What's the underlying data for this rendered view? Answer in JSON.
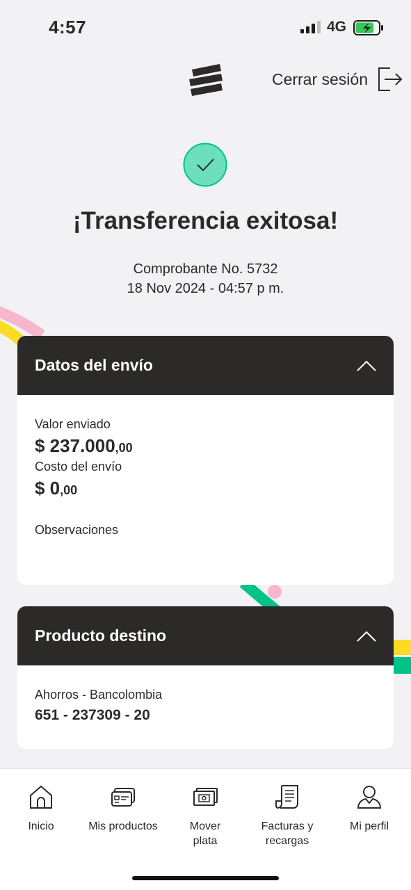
{
  "status_bar": {
    "time": "4:57",
    "network": "4G",
    "battery_level": 0.8,
    "battery_charging": true,
    "battery_color": "#34c759"
  },
  "header": {
    "logo_icon": "bancolombia-logo-icon",
    "logout_label": "Cerrar sesión",
    "logout_icon": "logout-icon"
  },
  "colors": {
    "dark": "#2c2a29",
    "success_green": "#6ce0bd",
    "accent_yellow": "#fdda24",
    "accent_pink": "#f7b6cc",
    "accent_green": "#00c389"
  },
  "result": {
    "icon": "check-circle-icon",
    "title": "¡Transferencia exitosa!",
    "voucher": "Comprobante No. 5732",
    "datetime": "18 Nov 2024 - 04:57 p m."
  },
  "shipment": {
    "title": "Datos del envío",
    "toggle_icon": "chevron-up-icon",
    "sent_label": "Valor enviado",
    "sent_amount": "$ 237.000",
    "sent_cents": ",00",
    "cost_label": "Costo del envío",
    "cost_amount": "$ 0",
    "cost_cents": ",00",
    "notes_label": "Observaciones"
  },
  "destination": {
    "title": "Producto destino",
    "toggle_icon": "chevron-up-icon",
    "account_type": "Ahorros - Bancolombia",
    "account_number": "651 - 237309 - 20"
  },
  "bottom_nav": {
    "items": [
      {
        "label": "Inicio",
        "icon": "home-icon"
      },
      {
        "label": "Mis productos",
        "icon": "cards-icon"
      },
      {
        "label": "Mover\nplata",
        "icon": "money-icon"
      },
      {
        "label": "Facturas y\nrecargas",
        "icon": "receipt-icon"
      },
      {
        "label": "Mi perfil",
        "icon": "profile-icon"
      }
    ]
  }
}
